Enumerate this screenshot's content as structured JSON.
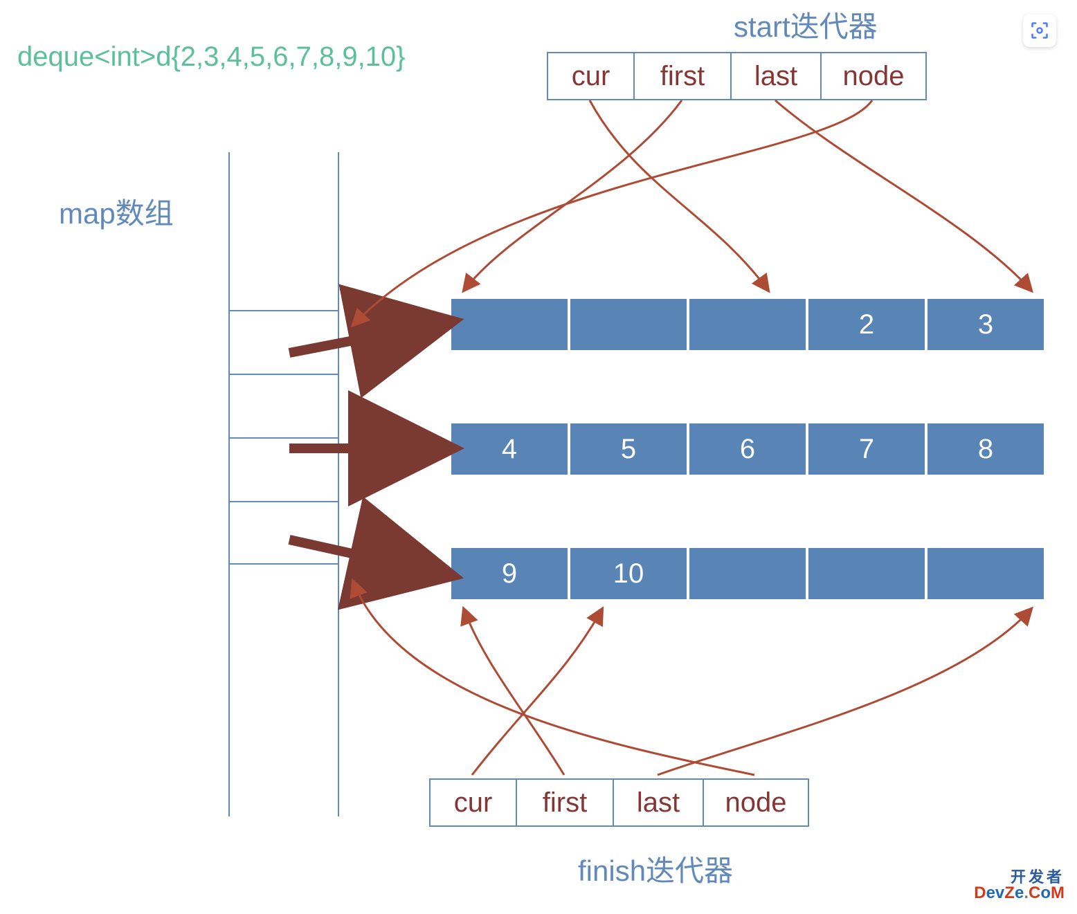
{
  "title": "deque<int>d{2,3,4,5,6,7,8,9,10}",
  "labels": {
    "start_iterator": "start迭代器",
    "finish_iterator": "finish迭代器",
    "map_array": "map数组"
  },
  "iterator_fields": {
    "cur": "cur",
    "first": "first",
    "last": "last",
    "node": "node"
  },
  "buffers": [
    [
      "",
      "",
      "",
      "2",
      "3"
    ],
    [
      "4",
      "5",
      "6",
      "7",
      "8"
    ],
    [
      "9",
      "10",
      "",
      "",
      ""
    ]
  ],
  "map_cells": 3,
  "colors": {
    "text_green": "#5bc09a",
    "text_blue": "#6189b9",
    "text_darkred": "#833634",
    "buffer_fill": "#5884b6",
    "arrow": "#ad4b35",
    "arrow_bold": "#7a3a32"
  },
  "watermark": {
    "line1": "开发者",
    "line2": "DevZe.CoM"
  }
}
